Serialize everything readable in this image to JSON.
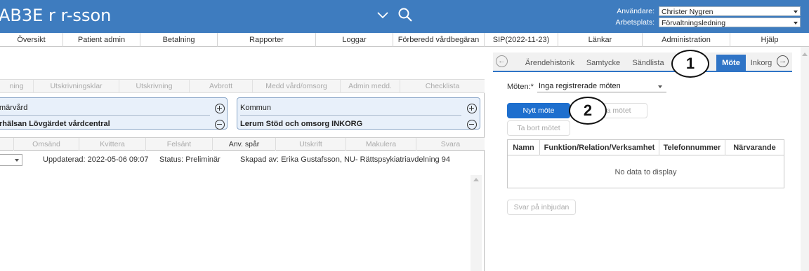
{
  "header": {
    "app_title": "AB3E r r-sson",
    "user_label": "Användare:",
    "user_value": "Christer Nygren",
    "workplace_label": "Arbetsplats:",
    "workplace_value": "Förvaltningsledning"
  },
  "menu": [
    "Översikt",
    "Patient admin",
    "Betalning",
    "Rapporter",
    "Loggar",
    "Förberedd vårdbegäran",
    "SIP(2022-11-23)",
    "Länkar",
    "Administration",
    "Hjälp"
  ],
  "status_tabs": [
    "ning",
    "Utskrivningsklar",
    "Utskrivning",
    "Avbrott",
    "Medd vård/omsorg",
    "Admin medd.",
    "Checklista"
  ],
  "parties": {
    "left_role": "märvård",
    "left_unit": "rhälsan Lövgärdet vårdcentral",
    "right_role": "Kommun",
    "right_unit": "Lerum Stöd och omsorg INKORG"
  },
  "actions": [
    "Omsänd",
    "Kvittera",
    "Felsänt",
    "Anv. spår",
    "Utskrift",
    "Makulera",
    "Svara"
  ],
  "doc_info": {
    "updated": "Uppdaterad: 2022-05-06 09:07",
    "status": "Status: Preliminär",
    "created_by": "Skapad av: Erika Gustafsson, NU- Rättspsykiatriavdelning 94"
  },
  "right_tabs": {
    "items": [
      "Ärendehistorik",
      "Samtycke",
      "Sändlista",
      "Möte",
      "Inkorg"
    ],
    "active": "Möte"
  },
  "callouts": [
    "1",
    "2"
  ],
  "meeting": {
    "label": "Möten:*",
    "select_value": "Inga registrerade möten",
    "new_button": "Nytt möte",
    "edit_button": "Ändra mötet",
    "delete_button": "Ta bort mötet",
    "reply_button": "Svar på inbjudan"
  },
  "grid": {
    "columns": [
      "Namn",
      "Funktion/Relation/Verksamhet",
      "Telefonnummer",
      "Närvarande"
    ],
    "empty_text": "No data to display"
  }
}
